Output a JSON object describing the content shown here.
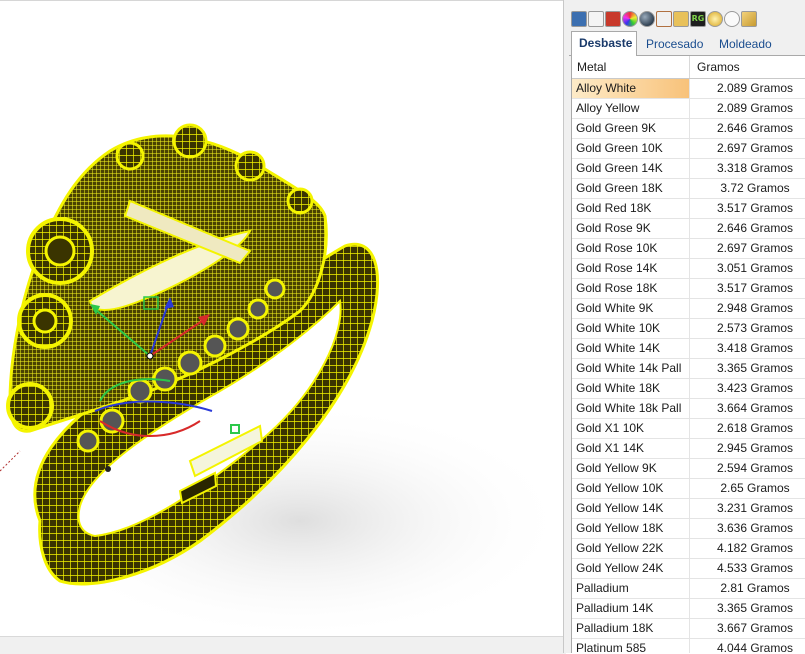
{
  "toolbar": {
    "icons": [
      "display-icon",
      "lamp-icon",
      "material-ball-icon",
      "color-wheel-icon",
      "sphere-icon",
      "brush-icon",
      "folder-icon",
      "rg-icon",
      "gem-icon",
      "clock-icon",
      "render-icon"
    ],
    "rg_label": "RG"
  },
  "tabs": [
    {
      "label": "Desbaste",
      "active": true
    },
    {
      "label": "Procesado",
      "active": false
    },
    {
      "label": "Moldeado",
      "active": false
    }
  ],
  "table": {
    "headers": {
      "metal": "Metal",
      "grams": "Gramos"
    },
    "selected_index": 0,
    "rows": [
      {
        "metal": "Alloy White",
        "grams": "2.089 Gramos"
      },
      {
        "metal": "Alloy Yellow",
        "grams": "2.089 Gramos"
      },
      {
        "metal": "Gold Green 9K",
        "grams": "2.646 Gramos"
      },
      {
        "metal": "Gold Green 10K",
        "grams": "2.697 Gramos"
      },
      {
        "metal": "Gold Green 14K",
        "grams": "3.318 Gramos"
      },
      {
        "metal": "Gold Green 18K",
        "grams": "3.72 Gramos"
      },
      {
        "metal": "Gold Red 18K",
        "grams": "3.517 Gramos"
      },
      {
        "metal": "Gold Rose 9K",
        "grams": "2.646 Gramos"
      },
      {
        "metal": "Gold Rose 10K",
        "grams": "2.697 Gramos"
      },
      {
        "metal": "Gold Rose 14K",
        "grams": "3.051 Gramos"
      },
      {
        "metal": "Gold Rose 18K",
        "grams": "3.517 Gramos"
      },
      {
        "metal": "Gold White 9K",
        "grams": "2.948 Gramos"
      },
      {
        "metal": "Gold White 10K",
        "grams": "2.573 Gramos"
      },
      {
        "metal": "Gold White 14K",
        "grams": "3.418 Gramos"
      },
      {
        "metal": "Gold White 14k Pall",
        "grams": "3.365 Gramos"
      },
      {
        "metal": "Gold White 18K",
        "grams": "3.423 Gramos"
      },
      {
        "metal": "Gold White 18k Pall",
        "grams": "3.664 Gramos"
      },
      {
        "metal": "Gold X1 10K",
        "grams": "2.618 Gramos"
      },
      {
        "metal": "Gold X1 14K",
        "grams": "2.945 Gramos"
      },
      {
        "metal": "Gold Yellow 9K",
        "grams": "2.594 Gramos"
      },
      {
        "metal": "Gold Yellow 10K",
        "grams": "2.65 Gramos"
      },
      {
        "metal": "Gold Yellow 14K",
        "grams": "3.231 Gramos"
      },
      {
        "metal": "Gold Yellow 18K",
        "grams": "3.636 Gramos"
      },
      {
        "metal": "Gold Yellow 22K",
        "grams": "4.182 Gramos"
      },
      {
        "metal": "Gold Yellow 24K",
        "grams": "4.533 Gramos"
      },
      {
        "metal": "Palladium",
        "grams": "2.81 Gramos"
      },
      {
        "metal": "Palladium 14K",
        "grams": "3.365 Gramos"
      },
      {
        "metal": "Palladium 18K",
        "grams": "3.667 Gramos"
      },
      {
        "metal": "Platinum 585",
        "grams": "4.044 Gramos"
      }
    ]
  },
  "colors": {
    "ring_wire": "#f2f200",
    "ring_dark": "#2a2600",
    "selection": "#f8c27a",
    "tab_text": "#1a4d8f"
  }
}
